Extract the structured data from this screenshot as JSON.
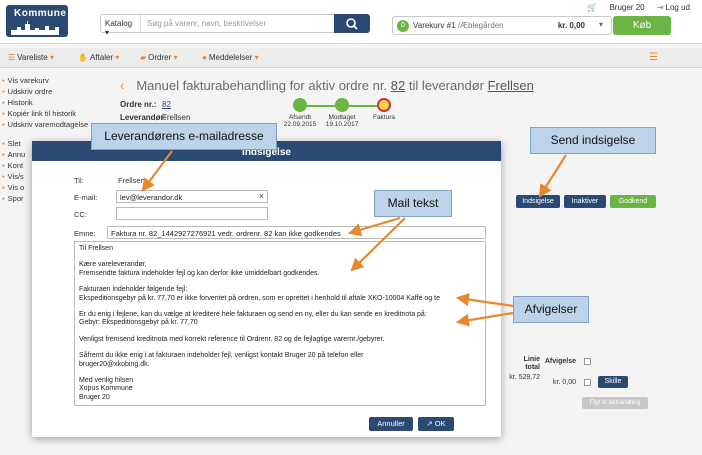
{
  "header": {
    "logo_text": "Kommune",
    "search_category": "Katalog",
    "search_placeholder": "Søg på varenr, navn, beskrivelser",
    "user": "Bruger 20",
    "logout": "Log ud",
    "cart_count": "0",
    "cart_label": "Varekurv #1",
    "cart_location": "/Æblegården",
    "cart_amount": "kr. 0,00",
    "buy_label": "Køb"
  },
  "nav": {
    "items": [
      "Vareliste",
      "Aftaler",
      "Ordrer",
      "Meddelelser"
    ]
  },
  "sidebar": {
    "group1": [
      "Vis varekurv",
      "Udskriv ordre",
      "Historik",
      "Kopiér link til historik",
      "Udskriv varemodtagelse"
    ],
    "group2": [
      "Slet",
      "Annu",
      "Kont",
      "Vis/s",
      "Vis o",
      "Spor"
    ]
  },
  "page": {
    "title_prefix": "Manuel fakturabehandling  for aktiv ordre nr.",
    "order_no": "82",
    "title_mid": "til leverandør",
    "supplier": "Frellsen",
    "order_label": "Ordre nr.:",
    "order_value": "82",
    "supplier_label": "Leverandør:",
    "supplier_value": "Frellsen",
    "progress": [
      {
        "label": "Afsendt",
        "date": "22.09.2015"
      },
      {
        "label": "Modtaget",
        "date": "19.10.2017"
      },
      {
        "label": "Faktura",
        "date": ""
      }
    ],
    "buttons": {
      "indsigelse": "Indsigelse",
      "inaktiver": "Inaktiver",
      "godkend": "Godkend"
    },
    "table": {
      "linie_total_label": "Linie total",
      "afvigelse_label": "Afvigelse",
      "row_value": "kr. 529,72",
      "row_afvigelse": "kr. 0,00",
      "skille": "Skille",
      "flyt": "Flyt til behandling"
    }
  },
  "modal": {
    "title": "Indsigelse",
    "til_label": "Til:",
    "til_value": "Frellsen",
    "email_label": "E-mail:",
    "email_value": "lev@leverandor.dk",
    "cc_label": "CC:",
    "cc_value": "",
    "emne_label": "Emne:",
    "emne_value": "Faktura nr. 82_1442927276921 vedr. ordrenr. 82 kan ikke godkendes",
    "body_lines": [
      "Til Frellsen",
      "",
      "Kære vareleverandør,",
      "Fremsendte faktura indeholder fejl og kan derfor ikke umiddelbart godkendes.",
      "",
      "Fakturaen indeholder følgende fejl:",
      "Ekspeditionsgebyr på kr. 77,70 er ikke forventet på ordren, som er oprettet i henhold til aftale XKO-10004 Kaffe og te",
      "",
      "Er du enig i fejlene, kan du vælge at kreditere hele fakturaen og send en ny, eller du kan sende en kreditnota på:",
      "Gebyr: Ekspeditionsgebyr på kr. 77,70",
      "",
      "Venligst fremsend kreditnota med korrekt reference til Ordrenr. 82 og de fejlagtige varernr./gebyrer.",
      "",
      "Såfremt du ikke enig i at fakturaen indeholder fejl, venligst  kontakt Bruger 20 på telefon  eller",
      "bruger20@xkobing.dk.",
      "",
      "Med venlig hilsen",
      "Xopus Kommune",
      "Bruger 20"
    ],
    "cancel_label": "Annuller",
    "ok_label": "OK"
  },
  "callouts": {
    "email": "Leverandørens e-mailadresse",
    "send": "Send indsigelse",
    "mail": "Mail tekst",
    "afvig": "Afvigelser"
  },
  "colors": {
    "primary": "#2b4a73",
    "accent": "#e7882e",
    "success": "#6bb545",
    "callout_bg": "#bcd3ea",
    "arrow": "#e7882e"
  }
}
